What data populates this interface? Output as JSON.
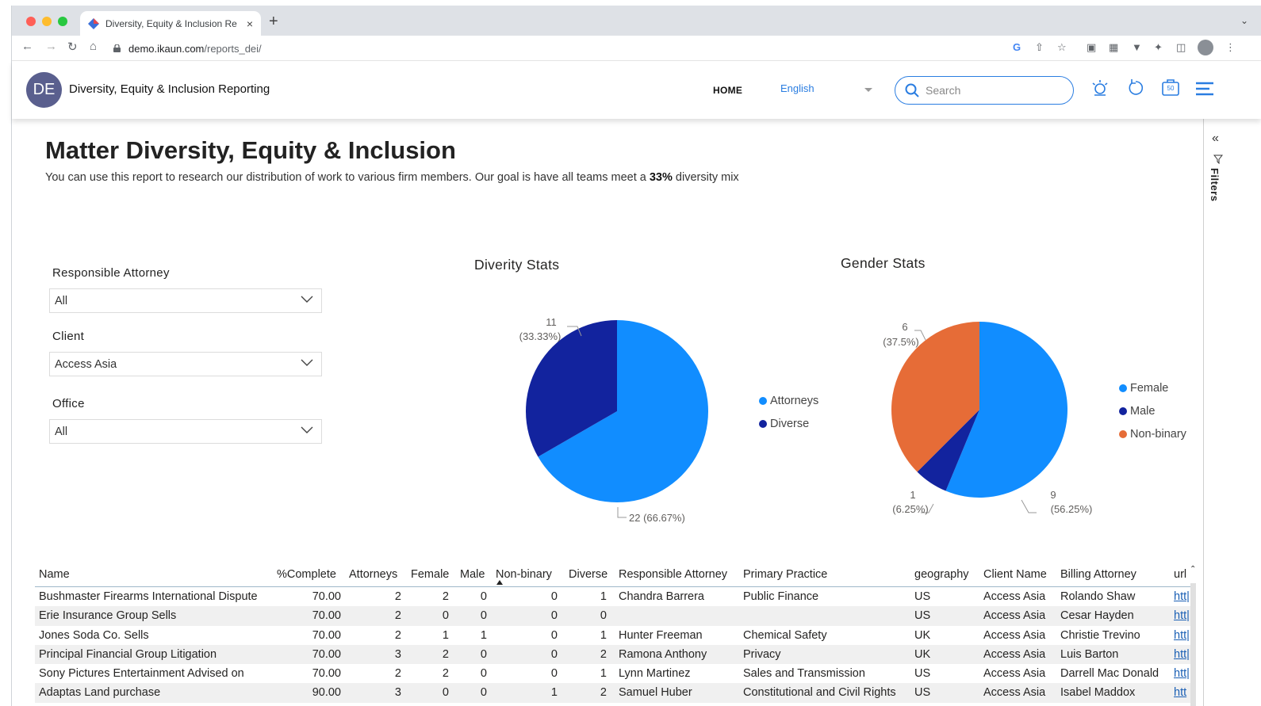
{
  "browser": {
    "tab_title": "Diversity, Equity & Inclusion Re",
    "tab_close": "×",
    "new_tab": "+",
    "url_host": "demo.ikaun.com",
    "url_path": "/reports_dei/"
  },
  "app": {
    "avatar_initials": "DE",
    "title": "Diversity, Equity & Inclusion Reporting",
    "nav_home": "HOME",
    "language": "English",
    "search_placeholder": "Search",
    "cart_count": "50"
  },
  "report": {
    "title": "Matter Diversity, Equity & Inclusion",
    "desc_before": "You can use this report to research our distribution of work to various firm members. Our goal is have all  teams meet a ",
    "desc_bold": "33%",
    "desc_after": " diversity mix"
  },
  "slicers": [
    {
      "label": "Responsible Attorney",
      "value": "All"
    },
    {
      "label": "Client",
      "value": "Access Asia"
    },
    {
      "label": "Office",
      "value": "All"
    }
  ],
  "filters_pane": {
    "label": "Filters"
  },
  "chart_data": [
    {
      "type": "pie",
      "title": "Diverity Stats",
      "categories": [
        "Attorneys",
        "Diverse"
      ],
      "values": [
        22,
        11
      ],
      "data_labels": [
        "22 (66.67%)",
        "11",
        "(33.33%)"
      ],
      "colors": [
        "#118dff",
        "#12239e"
      ],
      "legend": "right"
    },
    {
      "type": "pie",
      "title": "Gender Stats",
      "categories": [
        "Female",
        "Male",
        "Non-binary"
      ],
      "values": [
        9,
        1,
        6
      ],
      "data_labels": [
        "9",
        "(56.25%)",
        "1",
        "(6.25%)",
        "6",
        "(37.5%)"
      ],
      "colors": [
        "#118dff",
        "#12239e",
        "#e66c37"
      ],
      "legend": "right"
    }
  ],
  "table": {
    "columns": [
      "Name",
      "%Complete",
      "Attorneys",
      "Female",
      "Male",
      "Non-binary",
      "Diverse",
      "Responsible Attorney",
      "Primary Practice",
      "geography",
      "Client Name",
      "Billing Attorney",
      "url"
    ],
    "rows": [
      [
        "Bushmaster Firearms International Dispute",
        "70.00",
        "2",
        "2",
        "0",
        "0",
        "1",
        "Chandra Barrera",
        "Public Finance",
        "US",
        "Access Asia",
        "Rolando Shaw",
        "htt|"
      ],
      [
        "Erie Insurance Group Sells",
        "70.00",
        "2",
        "0",
        "0",
        "0",
        "0",
        "",
        "",
        "US",
        "Access Asia",
        "Cesar Hayden",
        "htt|"
      ],
      [
        "Jones Soda Co. Sells",
        "70.00",
        "2",
        "1",
        "1",
        "0",
        "1",
        "Hunter Freeman",
        "Chemical Safety",
        "UK",
        "Access Asia",
        "Christie Trevino",
        "htt|"
      ],
      [
        "Principal Financial Group Litigation",
        "70.00",
        "3",
        "2",
        "0",
        "0",
        "2",
        "Ramona Anthony",
        "Privacy",
        "UK",
        "Access Asia",
        "Luis Barton",
        "htt|"
      ],
      [
        "Sony Pictures Entertainment Advised on",
        "70.00",
        "2",
        "2",
        "0",
        "0",
        "1",
        "Lynn Martinez",
        "Sales and Transmission",
        "US",
        "Access Asia",
        "Darrell Mac Donald",
        "htt|"
      ],
      [
        "Adaptas Land purchase",
        "90.00",
        "3",
        "0",
        "0",
        "1",
        "2",
        "Samuel Huber",
        "Constitutional and Civil Rights",
        "US",
        "Access Asia",
        "Isabel Maddox",
        "htt"
      ]
    ]
  }
}
